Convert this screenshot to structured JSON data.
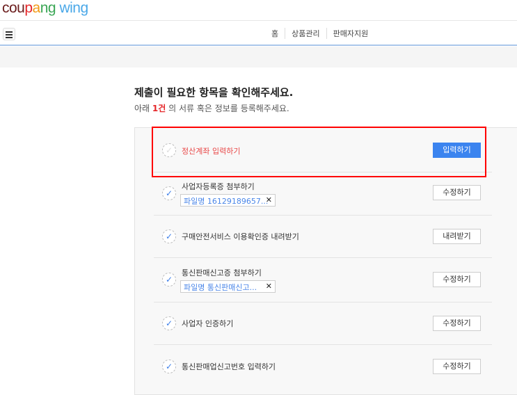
{
  "header": {
    "logo": [
      "cou",
      "p",
      "a",
      "n",
      "g",
      " wing"
    ],
    "logo_colors": [
      "#6b1d1d",
      "#e52528",
      "#f29b17",
      "#3aa655",
      "#3aa655",
      "#4aa8e8"
    ]
  },
  "nav": {
    "links": [
      "홈",
      "상품관리",
      "판매자지원"
    ]
  },
  "main": {
    "title": "제출이 필요한 항목을 확인해주세요.",
    "sub_pre": "아래 ",
    "sub_count": "1건",
    "sub_post": " 의 서류 혹은 정보를 등록해주세요."
  },
  "items": [
    {
      "label": "정산계좌 입력하기",
      "button": "입력하기",
      "done": false
    },
    {
      "label": "사업자등록증 첨부하기",
      "file": "파일명 16129189657...",
      "button": "수정하기",
      "done": true
    },
    {
      "label": "구매안전서비스 이용확인증 내려받기",
      "button": "내려받기",
      "done": true
    },
    {
      "label": "통신판매신고증 첨부하기",
      "file": "파일명 통신판매신고...",
      "button": "수정하기",
      "done": true
    },
    {
      "label": "사업자 인증하기",
      "button": "수정하기",
      "done": true
    },
    {
      "label": "통신판매업신고번호 입력하기",
      "button": "수정하기",
      "done": true
    }
  ],
  "icons": {
    "check": "✓",
    "remove": "✕"
  }
}
